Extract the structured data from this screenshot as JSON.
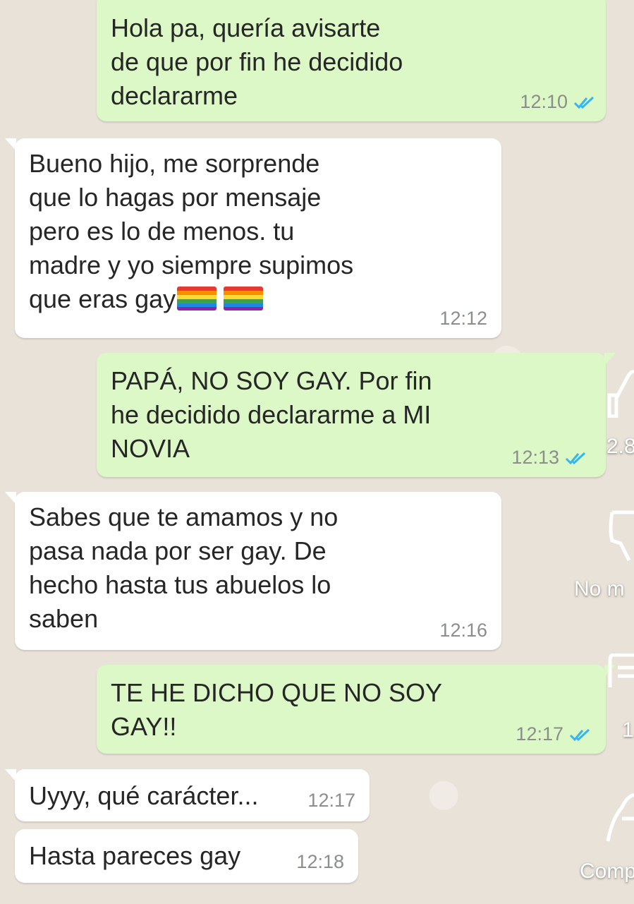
{
  "chat": {
    "messages": [
      {
        "direction": "outgoing",
        "text": "Hola pa, quería avisarte\nde que por fin he decidido\ndeclararme",
        "time": "12:10",
        "read": true
      },
      {
        "direction": "incoming",
        "text": "Bueno hijo, me sorprende\nque lo hagas por mensaje\npero es lo de menos. tu\nmadre y yo siempre supimos\nque eras gay",
        "time": "12:12",
        "emoji": [
          "rainbow-flag",
          "rainbow-flag"
        ]
      },
      {
        "direction": "outgoing",
        "text": "PAPÁ, NO SOY GAY. Por fin\nhe decidido declararme a MI\nNOVIA",
        "time": "12:13",
        "read": true
      },
      {
        "direction": "incoming",
        "text": "Sabes que te amamos y no\npasa nada por ser gay. De\nhecho hasta tus abuelos lo\nsaben",
        "time": "12:16"
      },
      {
        "direction": "outgoing",
        "text": "TE HE DICHO QUE NO SOY\nGAY!!",
        "time": "12:17",
        "read": true
      },
      {
        "direction": "incoming",
        "text": "Uyyy, qué carácter...",
        "time": "12:17"
      },
      {
        "direction": "incoming",
        "text": "Hasta pareces gay",
        "time": "12:18"
      }
    ]
  },
  "video_overlay": {
    "like_count": "2.8",
    "dislike_label": "No m",
    "comments_count": "1",
    "share_label": "Comp"
  },
  "colors": {
    "outgoing_bubble": "#dcf8c6",
    "incoming_bubble": "#ffffff",
    "read_ticks": "#34b7f1",
    "background": "#ece5dd"
  }
}
